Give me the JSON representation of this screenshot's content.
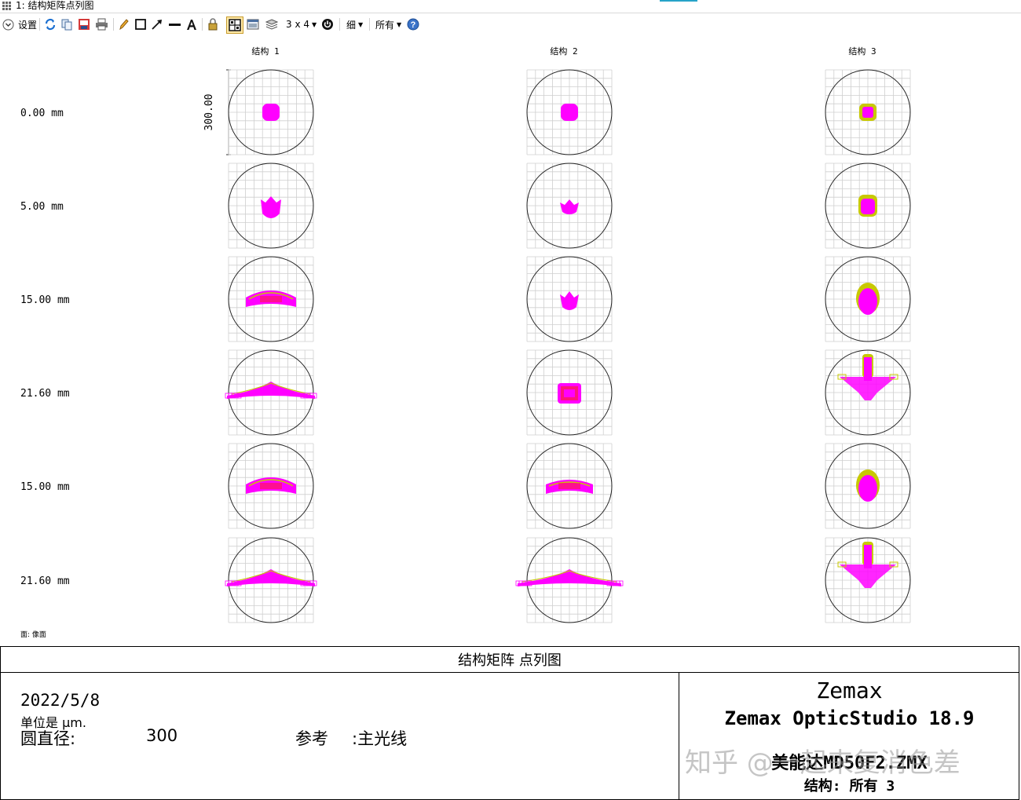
{
  "window": {
    "title": "1: 结构矩阵点列图"
  },
  "toolbar": {
    "settings_label": "设置",
    "layout_label": "3 x 4",
    "line_width_label": "细",
    "config_label": "所有"
  },
  "plot": {
    "columns": [
      "结构 1",
      "结构 2",
      "结构 3"
    ],
    "rows": [
      "0.00 mm",
      "5.00 mm",
      "15.00 mm",
      "21.60 mm",
      "15.00 mm",
      "21.60 mm"
    ],
    "scale_label": "300.00",
    "surface_label": "面: 像面",
    "colors": {
      "primary": "#ff00ff",
      "secondary": "#c8c800",
      "tertiary": "#ff2020",
      "grid": "#cfcfcf"
    }
  },
  "footer": {
    "title": "结构矩阵  点列图",
    "date": "2022/5/8",
    "units": "单位是  µm.",
    "circle_label": "圆直径:",
    "circle_value": "300",
    "reference_label": "参考",
    "reference_value": ":主光线",
    "brand": "Zemax",
    "product": "Zemax OpticStudio 18.9",
    "file": "美能达MD50F2.ZMX",
    "config": "结构: 所有 3"
  },
  "watermark": "知乎 @一起来复消色差"
}
